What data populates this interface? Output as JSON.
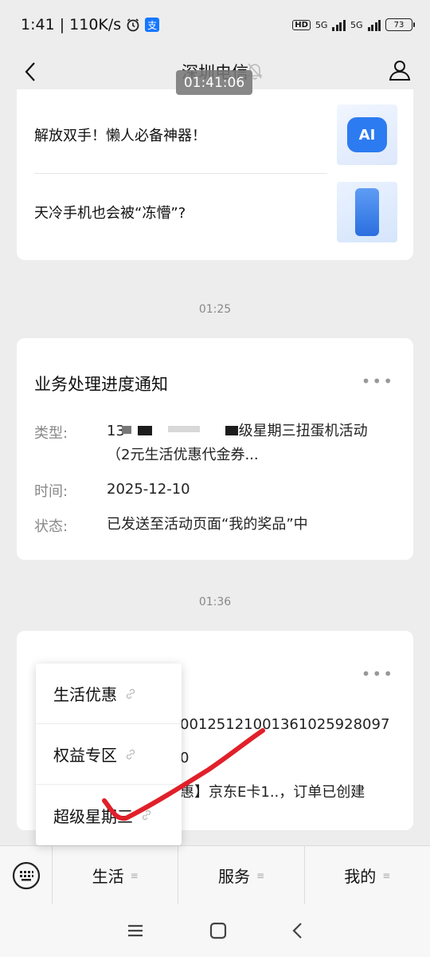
{
  "status_bar": {
    "time_speed": "1:41 | 110K/s",
    "alipay_glyph": "支",
    "hd": "HD",
    "network1": "5G",
    "network2": "5G",
    "battery": "73"
  },
  "header": {
    "title": "深圳电信",
    "recording_time": "01:41:06"
  },
  "news_card": {
    "items": [
      {
        "text": "解放双手！懒人必备神器！",
        "thumb_icon": "ai-badge-icon",
        "thumb_label": "AI"
      },
      {
        "text": "天冷手机也会被“冻懵”?",
        "thumb_icon": "phone-icon"
      }
    ]
  },
  "timestamps": [
    "01:25",
    "01:36"
  ],
  "progress_card": {
    "title": "业务处理进度通知",
    "more": "•••",
    "rows": [
      {
        "label": "类型:",
        "value_line1_start": "13",
        "value_line1_end": "级星期三扭蛋机活动",
        "value_line2": "（2元生活优惠代金券..."
      },
      {
        "label": "时间:",
        "value": "2025-12-10"
      },
      {
        "label": "状态:",
        "value": "已发送至活动页面“我的奖品”中"
      }
    ]
  },
  "order_card": {
    "more": "•••",
    "row1_value": "001251210013610259280​97",
    "row2_value": "0",
    "row3_value": "惠】京东E卡1..，订单已创建"
  },
  "popup_menu": {
    "items": [
      "生活优惠",
      "权益专区",
      "超级星期三"
    ]
  },
  "tab_bar": {
    "tabs": [
      "生活",
      "服务",
      "我的"
    ],
    "menu_glyph": "≡"
  },
  "colors": {
    "background": "#ededed",
    "card": "#ffffff",
    "annotation_red": "#e0202a",
    "ai_blue": "#2d7bf0"
  }
}
